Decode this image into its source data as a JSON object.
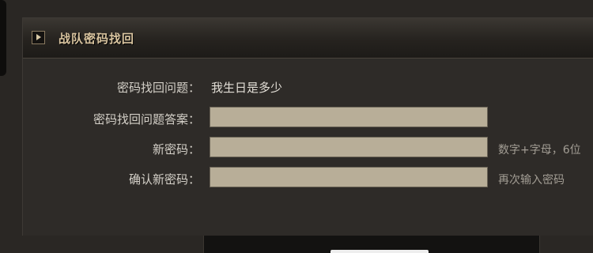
{
  "panel": {
    "title": "战队密码找回"
  },
  "form": {
    "question": {
      "label": "密码找回问题：",
      "value": "我生日是多少"
    },
    "answer": {
      "label": "密码找回问题答案：",
      "value": ""
    },
    "new_password": {
      "label": "新密码：",
      "value": "",
      "hint": "数字+字母，6位"
    },
    "confirm_password": {
      "label": "确认新密码：",
      "value": "",
      "hint": "再次输入密码"
    }
  },
  "icons": {
    "header": "play-arrow-icon"
  },
  "colors": {
    "background": "#2a2724",
    "title": "#d9c49f",
    "field": "#b8ae98",
    "hint": "#a29d94"
  }
}
